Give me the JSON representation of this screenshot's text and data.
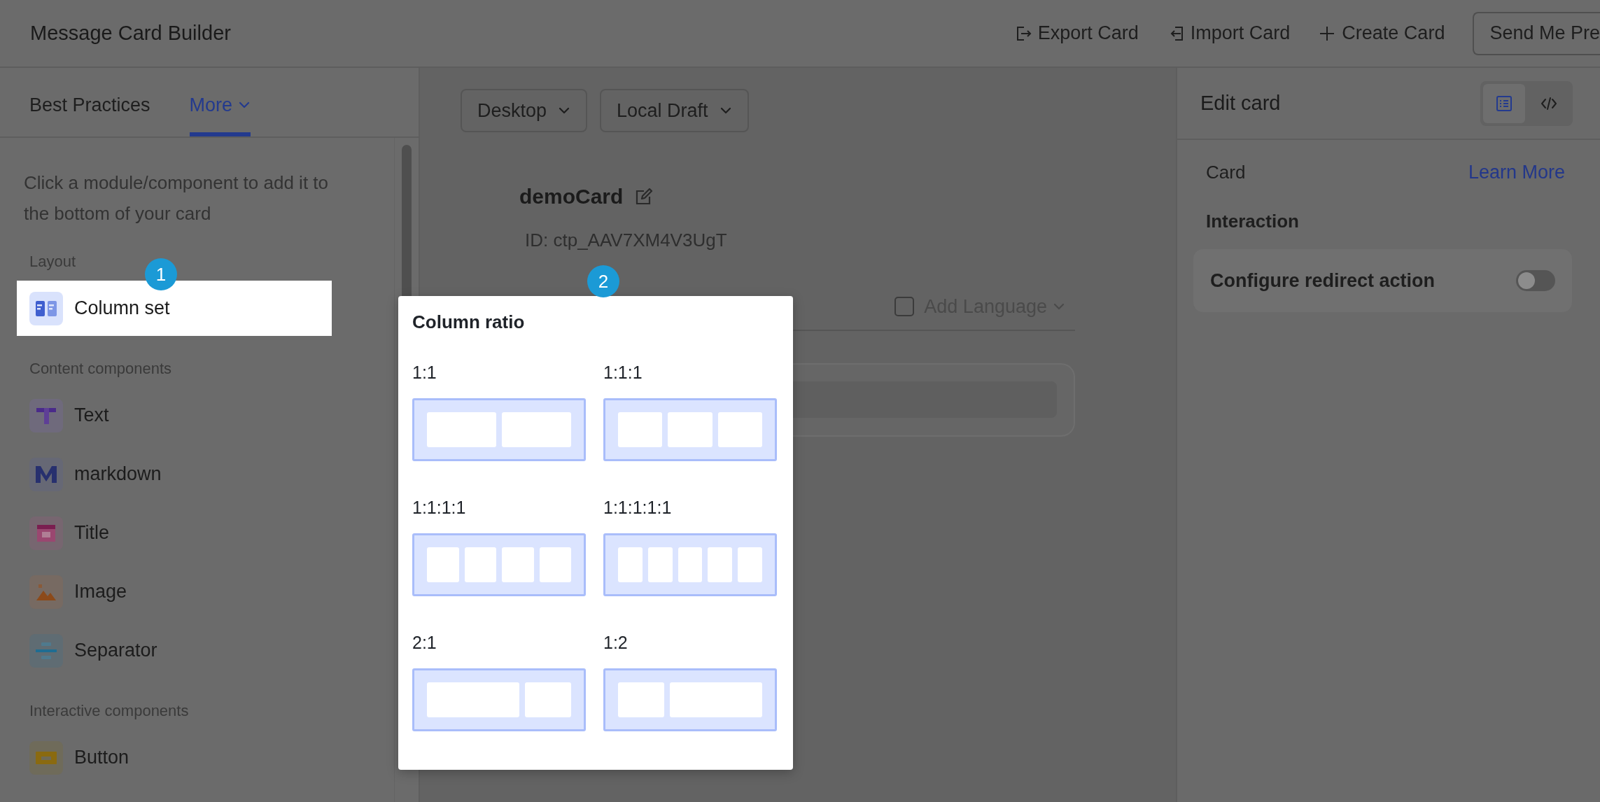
{
  "header": {
    "title": "Message Card Builder",
    "actions": [
      {
        "kind": "export",
        "label": "Export Card"
      },
      {
        "kind": "import",
        "label": "Import Card"
      },
      {
        "kind": "create",
        "label": "Create Card"
      },
      {
        "kind": "outlined",
        "label": "Send Me Pre"
      }
    ]
  },
  "sidebar": {
    "tabs": [
      {
        "label": "Best Practices",
        "selected": false,
        "dropdown": false
      },
      {
        "label": "More",
        "selected": true,
        "dropdown": true
      }
    ],
    "hint": "Click a module/component to add it to the bottom of your card",
    "sections": [
      {
        "title": "Layout",
        "items": [
          {
            "kind": "columns",
            "label": "Column set",
            "highlighted": true,
            "callout": "1"
          }
        ]
      },
      {
        "title": "Content components",
        "items": [
          {
            "kind": "text",
            "label": "Text",
            "highlighted": false
          },
          {
            "kind": "markdown",
            "label": "markdown",
            "highlighted": false
          },
          {
            "kind": "title",
            "label": "Title",
            "highlighted": false
          },
          {
            "kind": "image",
            "label": "Image",
            "highlighted": false
          },
          {
            "kind": "separator",
            "label": "Separator",
            "highlighted": false
          }
        ]
      },
      {
        "title": "Interactive components",
        "items": [
          {
            "kind": "button",
            "label": "Button",
            "highlighted": false
          }
        ]
      }
    ]
  },
  "canvas": {
    "device": "Desktop",
    "version": "Local Draft",
    "card_name": "demoCard",
    "card_id": "ID: ctp_AAV7XM4V3UgT",
    "add_language": {
      "label": "Add Language",
      "checked": false
    }
  },
  "popup": {
    "callout": "2",
    "title": "Column ratio",
    "options": [
      {
        "label": "1:1"
      },
      {
        "label": "1:1:1"
      },
      {
        "label": "1:1:1:1"
      },
      {
        "label": "1:1:1:1:1"
      },
      {
        "label": "2:1"
      },
      {
        "label": "1:2"
      }
    ]
  },
  "right_panel": {
    "title": "Edit card",
    "view_toggle": [
      {
        "kind": "form",
        "selected": true
      },
      {
        "kind": "code",
        "selected": false
      }
    ],
    "section_label": "Card",
    "link": "Learn More",
    "group_title": "Interaction",
    "settings": [
      {
        "label": "Configure redirect action",
        "on": false
      }
    ]
  }
}
